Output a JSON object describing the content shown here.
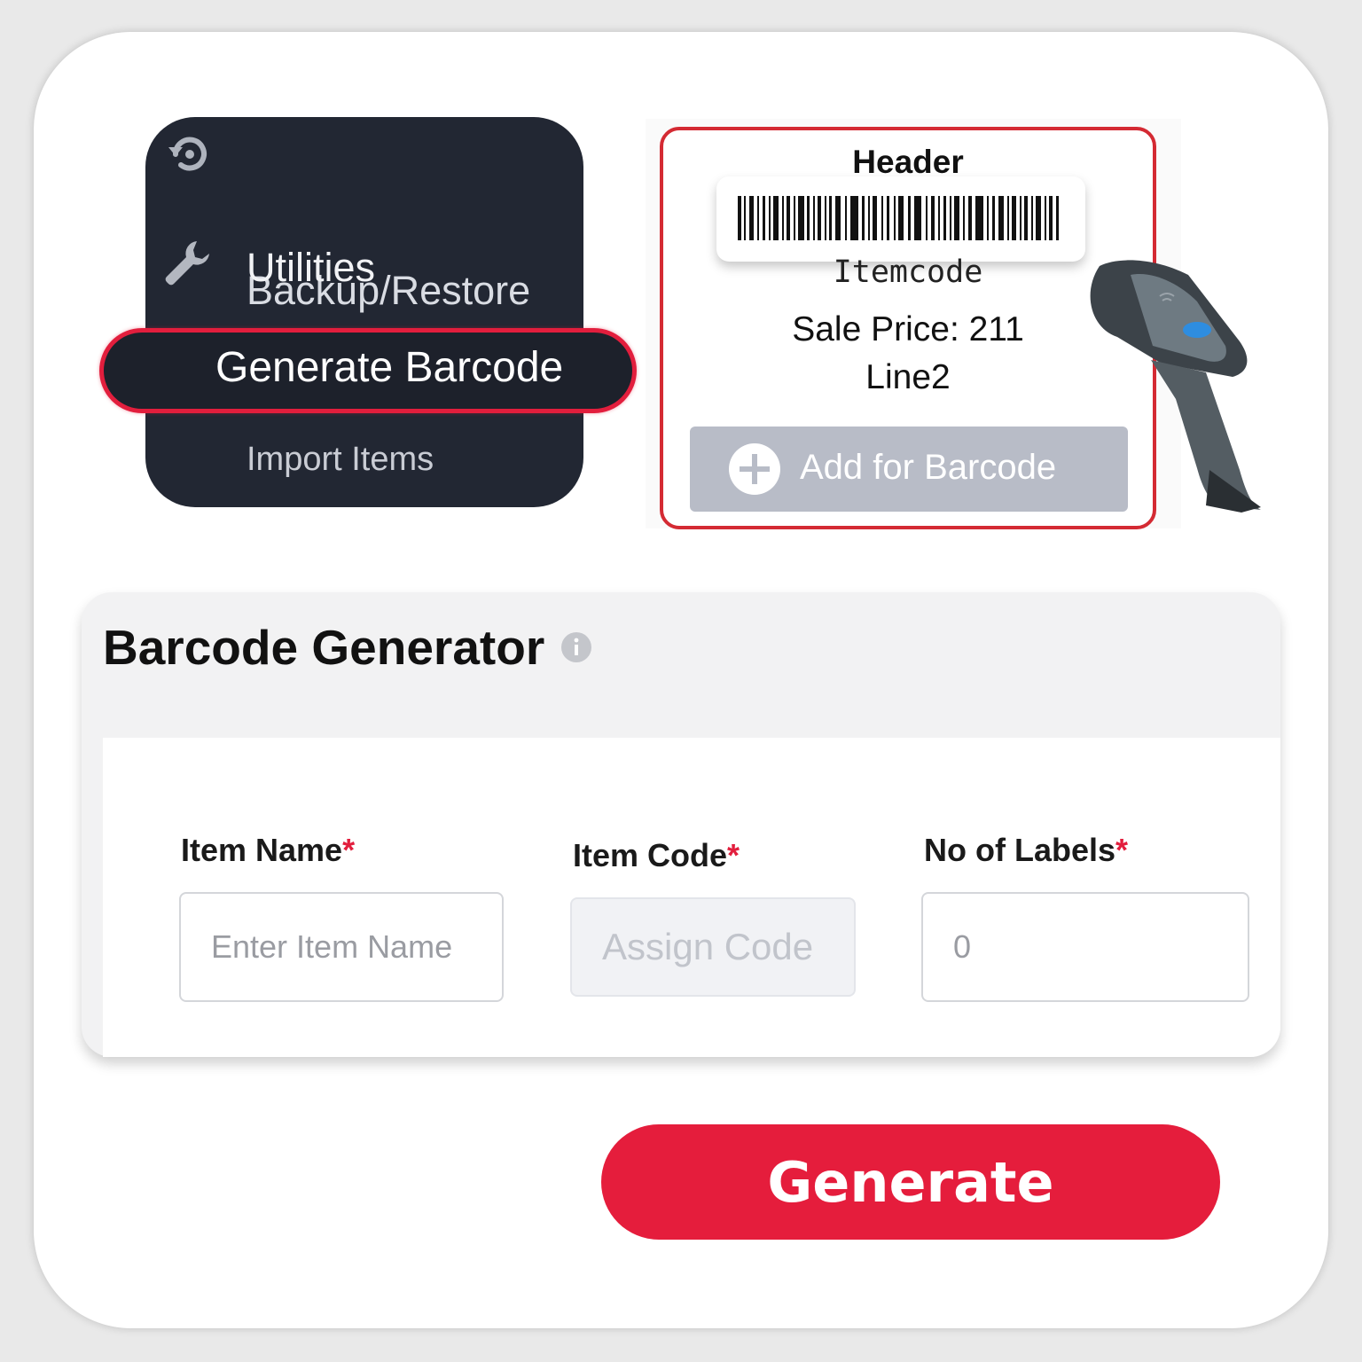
{
  "menu": {
    "items": [
      {
        "label": "Backup/Restore",
        "icon": "restore-icon"
      },
      {
        "label": "Utilities",
        "icon": "wrench-icon"
      },
      {
        "label": "Generate Barcode",
        "active": true
      },
      {
        "label": "Import Items"
      }
    ],
    "highlight_color": "#e21e3d"
  },
  "preview": {
    "header": "Header",
    "item_code": "Itemcode",
    "sale_price": "Sale Price: 211",
    "line2": "Line2",
    "add_button_label": "Add for Barcode",
    "border_color": "#d42a33"
  },
  "generator": {
    "title": "Barcode Generator",
    "fields": {
      "item_name": {
        "label": "Item Name",
        "placeholder": "Enter Item Name"
      },
      "item_code": {
        "label": "Item Code",
        "placeholder": "Assign Code"
      },
      "labels": {
        "label": "No of Labels",
        "value": "0"
      }
    },
    "required_mark": "*"
  },
  "actions": {
    "generate_label": "Generate",
    "accent_color": "#e51d3c"
  }
}
